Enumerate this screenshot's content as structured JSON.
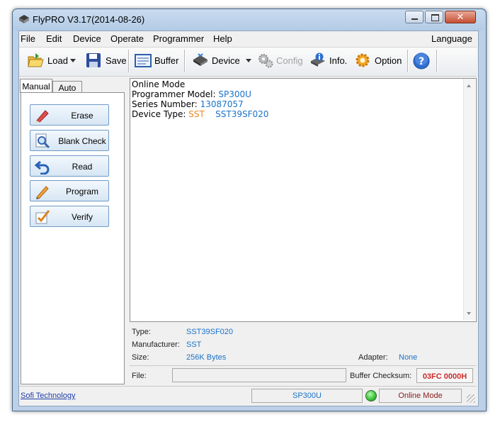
{
  "window": {
    "title": "FlyPRO V3.17(2014-08-26)"
  },
  "menu": {
    "items": [
      "File",
      "Edit",
      "Device",
      "Operate",
      "Programmer",
      "Help"
    ],
    "language": "Language"
  },
  "toolbar": {
    "load": "Load",
    "save": "Save",
    "buffer": "Buffer",
    "device": "Device",
    "config": "Config",
    "info": "Info.",
    "option": "Option"
  },
  "tabs": {
    "manual": "Manual",
    "auto": "Auto"
  },
  "operations": {
    "erase": "Erase",
    "blank_check": "Blank Check",
    "read": "Read",
    "program": "Program",
    "verify": "Verify"
  },
  "log": {
    "line1": "Online Mode",
    "model_label": "Programmer Model: ",
    "model_value": "SP300U",
    "serial_label": "Series Number: ",
    "serial_value": "13087057",
    "type_label": "Device Type: ",
    "type_maker": "SST",
    "type_part": "SST39SF020"
  },
  "info": {
    "type_label": "Type:",
    "type_value": "SST39SF020",
    "manufacturer_label": "Manufacturer:",
    "manufacturer_value": "SST",
    "size_label": "Size:",
    "size_value": "256K Bytes",
    "adapter_label": "Adapter:",
    "adapter_value": "None",
    "file_label": "File:",
    "file_value": "",
    "checksum_label": "Buffer Checksum:",
    "checksum_value": "03FC 0000H"
  },
  "status": {
    "company": "Sofi Technology",
    "programmer": "SP300U",
    "mode": "Online Mode",
    "indicator_color": "#3cc83c"
  },
  "colors": {
    "accent_blue": "#1a73c9",
    "maker_orange": "#e8891b",
    "checksum_red": "#cc2a2a"
  }
}
